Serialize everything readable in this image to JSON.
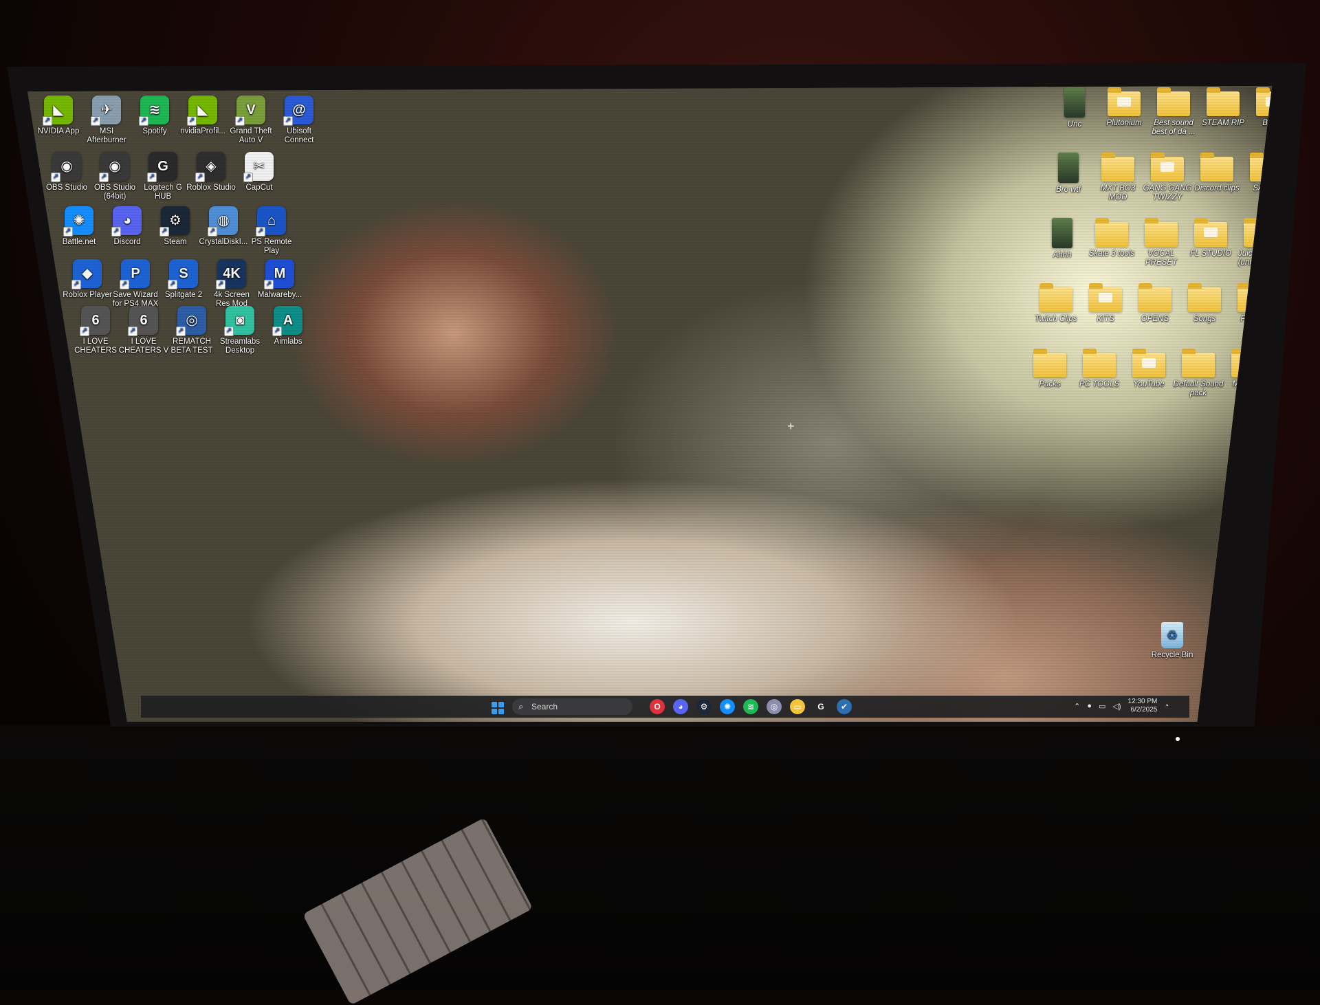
{
  "desktop": {
    "left_icons": [
      {
        "label": "NVIDIA App",
        "icon": "nvidia-icon",
        "color": "#76b900",
        "sym": "◣"
      },
      {
        "label": "MSI Afterburner",
        "icon": "msi-afterburner-icon",
        "color": "#8aa0b0",
        "sym": "✈"
      },
      {
        "label": "Spotify",
        "icon": "spotify-icon",
        "color": "#1db954",
        "sym": "≋"
      },
      {
        "label": "nvidiaProfil...",
        "icon": "nvidia-profile-inspector-icon",
        "color": "#76b900",
        "sym": "◣"
      },
      {
        "label": "Grand Theft Auto V",
        "icon": "gta-v-icon",
        "color": "#7a9f3b",
        "sym": "V"
      },
      {
        "label": "Ubisoft Connect",
        "icon": "ubisoft-icon",
        "color": "#2b5bd8",
        "sym": "@"
      },
      {
        "label": "OBS Studio",
        "icon": "obs-icon",
        "color": "#3a3a3a",
        "sym": "◉"
      },
      {
        "label": "OBS Studio (64bit)",
        "icon": "obs-64-icon",
        "color": "#3a3a3a",
        "sym": "◉"
      },
      {
        "label": "Logitech G HUB",
        "icon": "logitech-ghub-icon",
        "color": "#2a2a2a",
        "sym": "G"
      },
      {
        "label": "Roblox Studio",
        "icon": "roblox-studio-icon",
        "color": "#2e2e2e",
        "sym": "◈"
      },
      {
        "label": "CapCut",
        "icon": "capcut-icon",
        "color": "#f2f2f2",
        "sym": "✂"
      },
      {
        "label": "Battle.net",
        "icon": "battlenet-icon",
        "color": "#148eff",
        "sym": "✺"
      },
      {
        "label": "Discord",
        "icon": "discord-icon",
        "color": "#5865f2",
        "sym": "◕"
      },
      {
        "label": "Steam",
        "icon": "steam-icon",
        "color": "#1b2838",
        "sym": "⚙"
      },
      {
        "label": "CrystalDiskI...",
        "icon": "crystaldiskinfo-icon",
        "color": "#4f8fd8",
        "sym": "◍"
      },
      {
        "label": "PS Remote Play",
        "icon": "ps-remote-play-icon",
        "color": "#1a56c8",
        "sym": "⌂"
      },
      {
        "label": "Roblox Player",
        "icon": "roblox-player-icon",
        "color": "#1e63d6",
        "sym": "◆"
      },
      {
        "label": "Save Wizard for PS4 MAX",
        "icon": "save-wizard-icon",
        "color": "#1e63d6",
        "sym": "P"
      },
      {
        "label": "Splitgate 2",
        "icon": "splitgate-icon",
        "color": "#1e63d6",
        "sym": "S"
      },
      {
        "label": "4k Screen Res Mod",
        "icon": "4k-screen-res-icon",
        "color": "#17355f",
        "sym": "4K"
      },
      {
        "label": "Malwareby...",
        "icon": "malwarebytes-icon",
        "color": "#1e4fd6",
        "sym": "M"
      },
      {
        "label": "I LOVE CHEATERS",
        "icon": "rainbow-six-icon",
        "color": "#555555",
        "sym": "6"
      },
      {
        "label": "I LOVE CHEATERS V",
        "icon": "rainbow-six-v-icon",
        "color": "#555555",
        "sym": "6"
      },
      {
        "label": "REMATCH BETA TEST",
        "icon": "rematch-icon",
        "color": "#2d5ea8",
        "sym": "◎"
      },
      {
        "label": "Streamlabs Desktop",
        "icon": "streamlabs-icon",
        "color": "#31c3a2",
        "sym": "◙"
      },
      {
        "label": "Aimlabs",
        "icon": "aimlabs-icon",
        "color": "#0e8f8a",
        "sym": "A"
      }
    ],
    "right_icons": [
      {
        "label": "Unc",
        "type": "photo"
      },
      {
        "label": "Plutonium",
        "type": "folder"
      },
      {
        "label": "Best sound best of da ...",
        "type": "folder"
      },
      {
        "label": "STEAM RIP",
        "type": "folder"
      },
      {
        "label": "Beats",
        "type": "folder"
      },
      {
        "label": "Bro wtf",
        "type": "photo"
      },
      {
        "label": "MXT BO3 MOD",
        "type": "folder"
      },
      {
        "label": "GANG GANG TWIZZY",
        "type": "folder"
      },
      {
        "label": "Discord clips",
        "type": "folder"
      },
      {
        "label": "SAUCE",
        "type": "folder"
      },
      {
        "label": "Ahhh",
        "type": "photo"
      },
      {
        "label": "Skate 3 tools",
        "type": "folder"
      },
      {
        "label": "VOCAL PRESET",
        "type": "folder"
      },
      {
        "label": "FL STUDIO",
        "type": "folder"
      },
      {
        "label": "Juice WRLD (unreleased)",
        "type": "folder"
      },
      {
        "label": "Twitch Clips",
        "type": "folder"
      },
      {
        "label": "KITS",
        "type": "folder"
      },
      {
        "label": "OPENS",
        "type": "folder"
      },
      {
        "label": "Songs",
        "type": "folder"
      },
      {
        "label": "Presets",
        "type": "folder"
      },
      {
        "label": "Packs",
        "type": "folder"
      },
      {
        "label": "PC TOOLS",
        "type": "folder"
      },
      {
        "label": "YouTube",
        "type": "folder"
      },
      {
        "label": "Default Sound pack",
        "type": "folder"
      },
      {
        "label": "Montage Songs",
        "type": "folder"
      }
    ],
    "recycle_bin": {
      "label": "Recycle Bin"
    }
  },
  "taskbar": {
    "search_placeholder": "Search",
    "apps": [
      {
        "name": "opera-gx-icon",
        "color": "#e0313f",
        "sym": "O"
      },
      {
        "name": "discord-icon",
        "color": "#5865f2",
        "sym": "◕"
      },
      {
        "name": "steam-icon",
        "color": "#1b2838",
        "sym": "⚙"
      },
      {
        "name": "battlenet-icon",
        "color": "#148eff",
        "sym": "✺"
      },
      {
        "name": "spotify-icon",
        "color": "#1db954",
        "sym": "≋"
      },
      {
        "name": "chrome-icon",
        "color": "#8a8fb0",
        "sym": "◎"
      },
      {
        "name": "file-explorer-icon",
        "color": "#f2c43c",
        "sym": "▭"
      },
      {
        "name": "logitech-ghub-icon",
        "color": "#2a2a2a",
        "sym": "G"
      },
      {
        "name": "steam-vr-icon",
        "color": "#2d6fb0",
        "sym": "✔"
      }
    ],
    "clock": {
      "time": "12:30 PM",
      "date": "6/2/2025"
    }
  }
}
